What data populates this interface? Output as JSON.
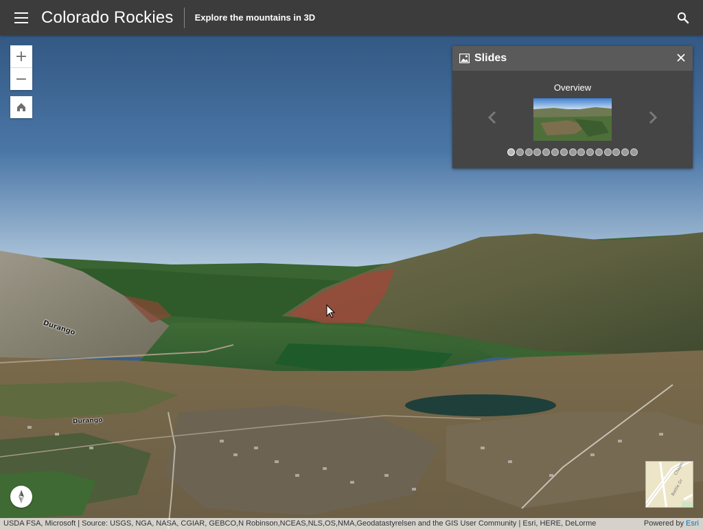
{
  "header": {
    "title": "Colorado Rockies",
    "subtitle": "Explore the mountains in 3D"
  },
  "icons": {
    "menu": "hamburger-icon",
    "search": "search-icon",
    "zoom_in": "plus-icon",
    "zoom_out": "minus-icon",
    "home": "home-icon",
    "slides_header": "image-icon",
    "close": "close-icon",
    "previous": "chevron-left-icon",
    "next": "chevron-right-icon",
    "compass": "compass-icon"
  },
  "map_controls": {
    "zoom_in_label": "+",
    "zoom_out_label": "−"
  },
  "slides": {
    "title": "Slides",
    "current_slide": "Overview",
    "slide_count": 15,
    "active_index": 0
  },
  "map_labels": {
    "town_upper": "Durango",
    "town_lower": "Durango"
  },
  "overview_map": {
    "street_1": "Chapman",
    "street_2": "Battle Dr"
  },
  "attribution": {
    "sources": "USDA FSA, Microsoft | Source: USGS, NGA, NASA, CGIAR, GEBCO,N Robinson,NCEAS,NLS,OS,NMA,Geodatastyrelsen and the GIS User Community | Esri, HERE, DeLorme",
    "powered_by": "Powered by",
    "powered_link": "Esri"
  },
  "colors": {
    "header_bg": "#3c3c3c",
    "panel_bg": "#454545",
    "panel_header_bg": "#5a5a5a",
    "link": "#0079c1"
  }
}
